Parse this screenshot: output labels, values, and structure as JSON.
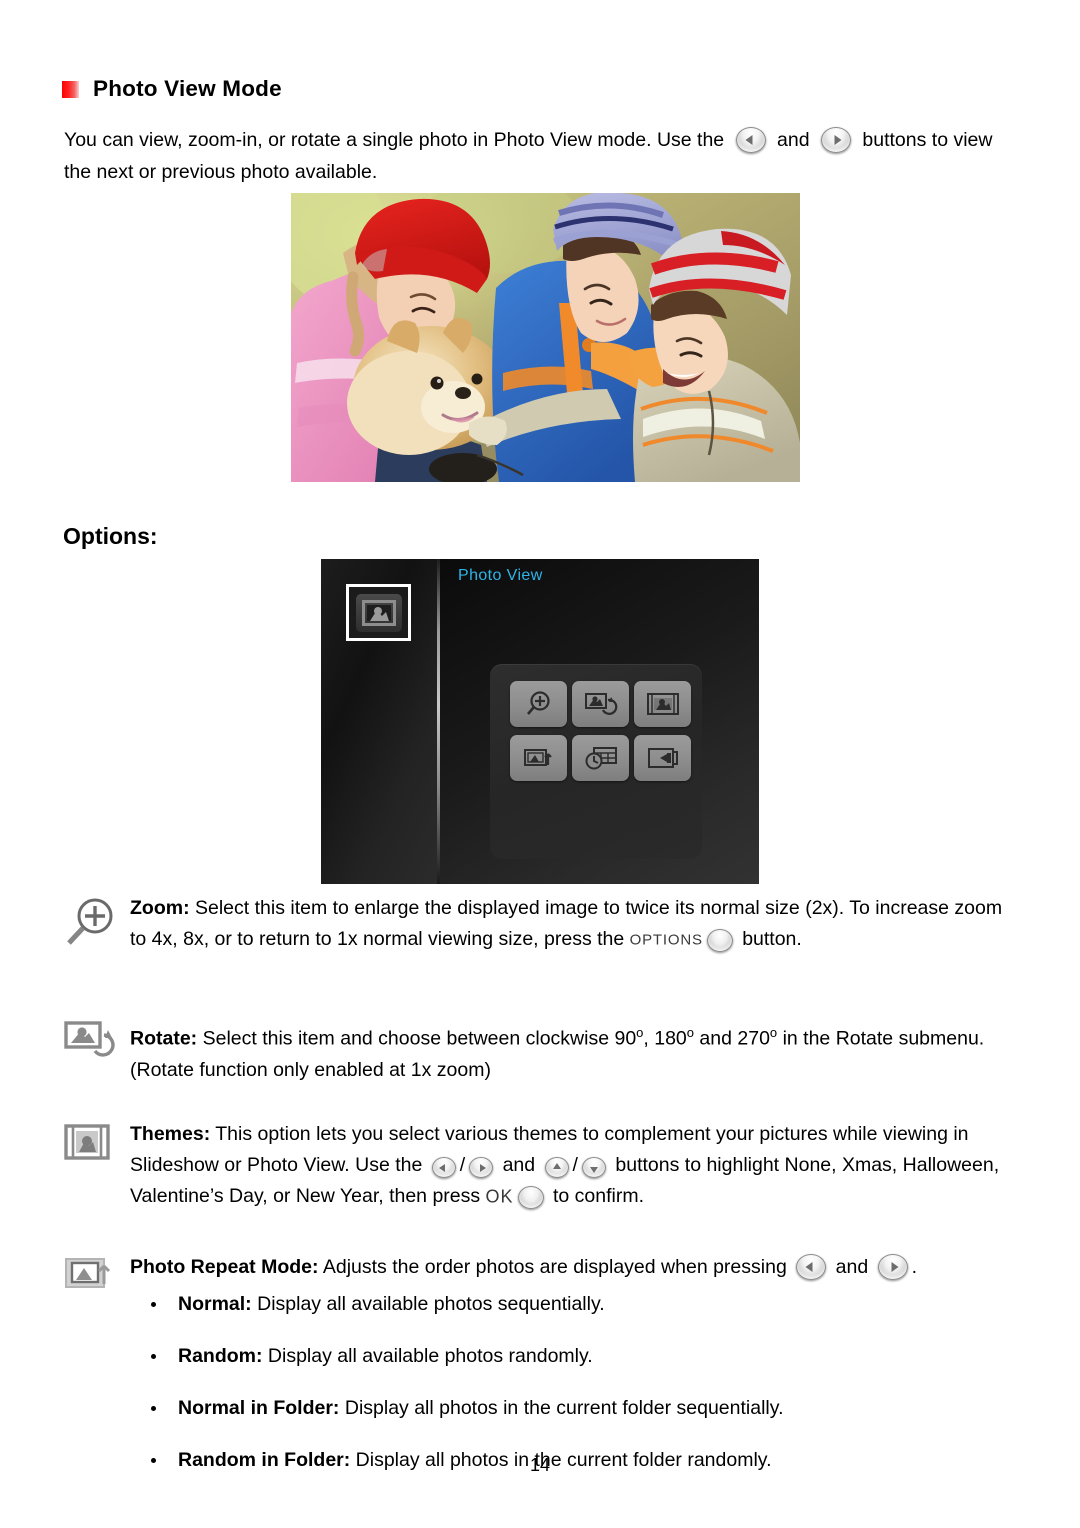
{
  "document": {
    "heading": "Photo View Mode",
    "page_number": "14",
    "options_label": "Options:",
    "accent_color": "#ff0000"
  },
  "intro": {
    "part1": "You can view, zoom-in, or rotate a single photo in Photo View mode. Use the",
    "part2": "and",
    "part3": "buttons to view the next or previous photo available."
  },
  "photo": {
    "alt": "Three children in winter hats petting a Pomeranian dog outdoors"
  },
  "device_screen": {
    "title": "Photo View",
    "title_color": "#2fb4e8",
    "sidebar_icon": "photo-view-icon",
    "grid_icons": [
      "zoom-in-icon",
      "rotate-icon",
      "themes-icon",
      "photo-repeat-mode-icon",
      "slideshow-interval-icon",
      "exit-icon"
    ]
  },
  "options": [
    {
      "icon": "zoom-in-icon",
      "title": "Zoom:",
      "text_a": " Select this item to enlarge the displayed image to twice its normal size (2x). To increase zoom to 4x, 8x, or to return to 1x normal viewing size, press the",
      "key_label": "OPTIONS",
      "text_b": "button."
    },
    {
      "icon": "rotate-icon",
      "title": "Rotate:",
      "text_a": " Select this item and choose between clockwise 90",
      "deg1": "o",
      "text_b": ", 180",
      "deg2": "o",
      "text_c": " and 270",
      "deg3": "o",
      "text_d": " in the Rotate submenu. (Rotate function only enabled at 1x zoom)"
    },
    {
      "icon": "themes-icon",
      "title": "Themes:",
      "text_a": " This option lets you select various themes to complement your pictures while viewing in Slideshow or Photo View. Use the",
      "sep": "/",
      "text_b": "and",
      "text_c": "buttons to highlight None, Xmas, Halloween, Valentine’s Day, or New Year, then press",
      "key_label": "OK",
      "text_d": "to confirm."
    },
    {
      "icon": "photo-repeat-mode-icon",
      "title": "Photo Repeat Mode:",
      "text_a": " Adjusts the order photos are displayed when pressing",
      "text_b": "and",
      "text_c": "."
    }
  ],
  "repeat_modes": [
    {
      "name": "Normal:",
      "desc": " Display all available photos sequentially."
    },
    {
      "name": "Random:",
      "desc": " Display all available photos randomly."
    },
    {
      "name": "Normal in Folder:",
      "desc": " Display all photos in the current folder sequentially."
    },
    {
      "name": "Random in Folder:",
      "desc": " Display all photos in the current folder randomly."
    }
  ]
}
